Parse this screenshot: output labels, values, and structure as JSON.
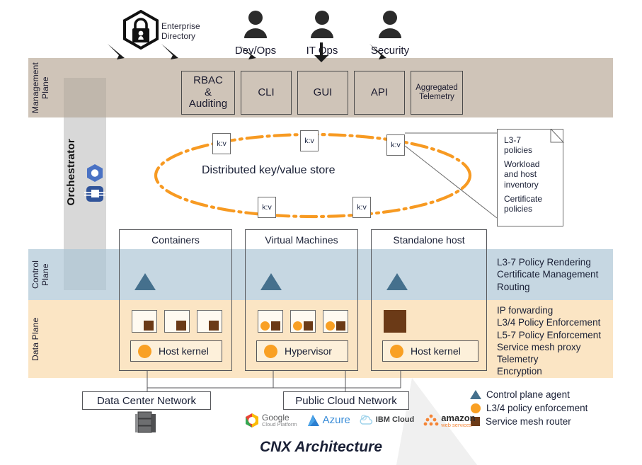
{
  "title": "CNX Architecture",
  "planes": {
    "management": {
      "label": "Management\nPlane",
      "color": "#cfc4b8"
    },
    "control": {
      "label": "Control\nPlane",
      "color": "#c6d7e2"
    },
    "data": {
      "label": "Data Plane",
      "color": "#fbe5c4"
    }
  },
  "orchestrator": {
    "label": "Orchestrator"
  },
  "actors": [
    {
      "name": "enterprise-directory",
      "label": "Enterprise\nDirectory",
      "icon": "lock-hexagon-icon"
    },
    {
      "name": "devops",
      "label": "Dev/Ops",
      "icon": "person-icon"
    },
    {
      "name": "itops",
      "label": "IT Ops",
      "icon": "person-icon"
    },
    {
      "name": "security",
      "label": "Security",
      "icon": "person-icon"
    }
  ],
  "management_boxes": [
    {
      "label": "RBAC\n&\nAuditing",
      "size": "normal"
    },
    {
      "label": "CLI",
      "size": "normal"
    },
    {
      "label": "GUI",
      "size": "normal"
    },
    {
      "label": "API",
      "size": "normal"
    },
    {
      "label": "Aggregated\nTelemetry",
      "size": "small"
    }
  ],
  "kv_store": {
    "title": "Distributed key/value store",
    "node_label": "k:v",
    "node_count": 5,
    "ring_color": "#f79a22"
  },
  "note": {
    "lines": [
      "L3-7\npolicies",
      "Workload\nand host\ninventory",
      "Certificate\npolicies"
    ]
  },
  "workload_columns": [
    {
      "title": "Containers",
      "kernel_label": "Host kernel",
      "units": [
        {
          "has_circle": false,
          "has_square": true
        },
        {
          "has_circle": false,
          "has_square": true
        },
        {
          "has_circle": false,
          "has_square": true
        }
      ]
    },
    {
      "title": "Virtual Machines",
      "kernel_label": "Hypervisor",
      "units": [
        {
          "has_circle": true,
          "has_square": true
        },
        {
          "has_circle": true,
          "has_square": true
        },
        {
          "has_circle": true,
          "has_square": true
        }
      ]
    },
    {
      "title": "Standalone host",
      "kernel_label": "Host kernel",
      "units": [
        {
          "has_circle": false,
          "has_square": true,
          "large": true
        }
      ]
    }
  ],
  "control_plane_functions": "L3-7 Policy Rendering\nCertificate Management\nRouting",
  "data_plane_functions": "IP forwarding\nL3/4 Policy Enforcement\nL5-7 Policy Enforcement\nService mesh proxy\nTelemetry\nEncryption",
  "networks": [
    {
      "label": "Data Center Network"
    },
    {
      "label": "Public Cloud Network"
    }
  ],
  "legend": [
    {
      "marker": "triangle",
      "color": "#45708d",
      "label": "Control plane agent"
    },
    {
      "marker": "circle",
      "color": "#f9a024",
      "label": "L3/4 policy enforcement"
    },
    {
      "marker": "square",
      "color": "#6b3a17",
      "label": "Service mesh router"
    }
  ],
  "cloud_logos": [
    {
      "name": "google-cloud-platform",
      "primary": "Google",
      "secondary": "Cloud Platform"
    },
    {
      "name": "azure",
      "primary": "Azure",
      "secondary": ""
    },
    {
      "name": "ibm-cloud",
      "primary": "IBM Cloud",
      "secondary": ""
    },
    {
      "name": "amazon-web-services",
      "primary": "amazon",
      "secondary": "web services"
    }
  ]
}
